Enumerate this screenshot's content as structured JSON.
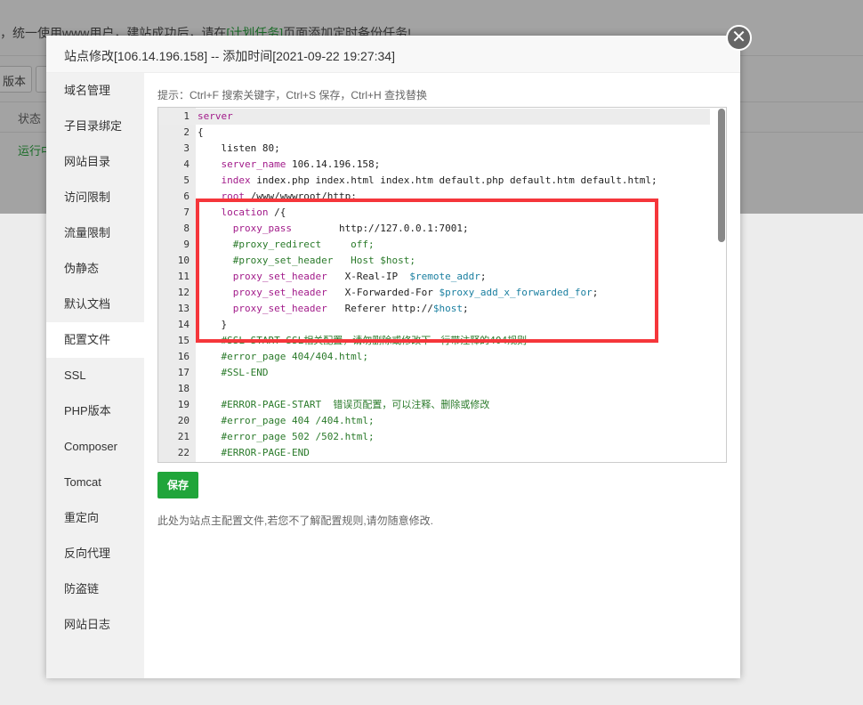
{
  "background": {
    "notice": "，统一使用www用户，建站成功后，请在",
    "notice_link": "[计划任务]",
    "notice_end": "页面添加定时备份任务!",
    "version_button": "版本",
    "status_header": "状态",
    "status_running": "运行中"
  },
  "modal": {
    "title": "站点修改[106.14.196.158] -- 添加时间[2021-09-22 19:27:34]",
    "close_icon": "close-icon",
    "sidebar": [
      "域名管理",
      "子目录绑定",
      "网站目录",
      "访问限制",
      "流量限制",
      "伪静态",
      "默认文档",
      "配置文件",
      "SSL",
      "PHP版本",
      "Composer",
      "Tomcat",
      "重定向",
      "反向代理",
      "防盗链",
      "网站日志"
    ],
    "active_item": "配置文件",
    "hint": "提示：Ctrl+F 搜索关键字，Ctrl+S 保存，Ctrl+H 查找替换",
    "code_lines": [
      [
        [
          "kw",
          "server"
        ]
      ],
      [
        [
          "",
          "{"
        ]
      ],
      [
        [
          "",
          "    listen 80;"
        ]
      ],
      [
        [
          "kw",
          "    server_name"
        ],
        [
          "",
          " 106.14.196.158;"
        ]
      ],
      [
        [
          "kw",
          "    index"
        ],
        [
          "",
          " index.php index.html index.htm default.php default.htm default.html;"
        ]
      ],
      [
        [
          "kw",
          "    root"
        ],
        [
          "",
          " /www/wwwroot/http;"
        ]
      ],
      [
        [
          "kw",
          "    location"
        ],
        [
          "",
          " /{"
        ]
      ],
      [
        [
          "kw",
          "      proxy_pass"
        ],
        [
          "",
          "        http://127.0.0.1:7001;"
        ]
      ],
      [
        [
          "cm",
          "      #proxy_redirect     off;"
        ]
      ],
      [
        [
          "cm",
          "      #proxy_set_header   Host $host;"
        ]
      ],
      [
        [
          "kw",
          "      proxy_set_header"
        ],
        [
          "",
          "   X-Real-IP  "
        ],
        [
          "var",
          "$remote_addr"
        ],
        [
          "",
          ";"
        ]
      ],
      [
        [
          "kw",
          "      proxy_set_header"
        ],
        [
          "",
          "   X-Forwarded-For "
        ],
        [
          "var",
          "$proxy_add_x_forwarded_for"
        ],
        [
          "",
          ";"
        ]
      ],
      [
        [
          "kw",
          "      proxy_set_header"
        ],
        [
          "",
          "   Referer http://"
        ],
        [
          "var",
          "$host"
        ],
        [
          "",
          ";"
        ]
      ],
      [
        [
          "",
          "    }"
        ]
      ],
      [
        [
          "cm",
          "    #SSL-START SSL相关配置，请勿删除或修改下一行带注释的404规则"
        ]
      ],
      [
        [
          "cm",
          "    #error_page 404/404.html;"
        ]
      ],
      [
        [
          "cm",
          "    #SSL-END"
        ]
      ],
      [
        [
          "",
          ""
        ]
      ],
      [
        [
          "cm",
          "    #ERROR-PAGE-START  错误页配置，可以注释、删除或修改"
        ]
      ],
      [
        [
          "cm",
          "    #error_page 404 /404.html;"
        ]
      ],
      [
        [
          "cm",
          "    #error_page 502 /502.html;"
        ]
      ],
      [
        [
          "cm",
          "    #ERROR-PAGE-END"
        ]
      ]
    ],
    "save_label": "保存",
    "note": "此处为站点主配置文件,若您不了解配置规则,请勿随意修改.",
    "highlight_color": "#f5363b",
    "accent_color": "#20a53a"
  }
}
